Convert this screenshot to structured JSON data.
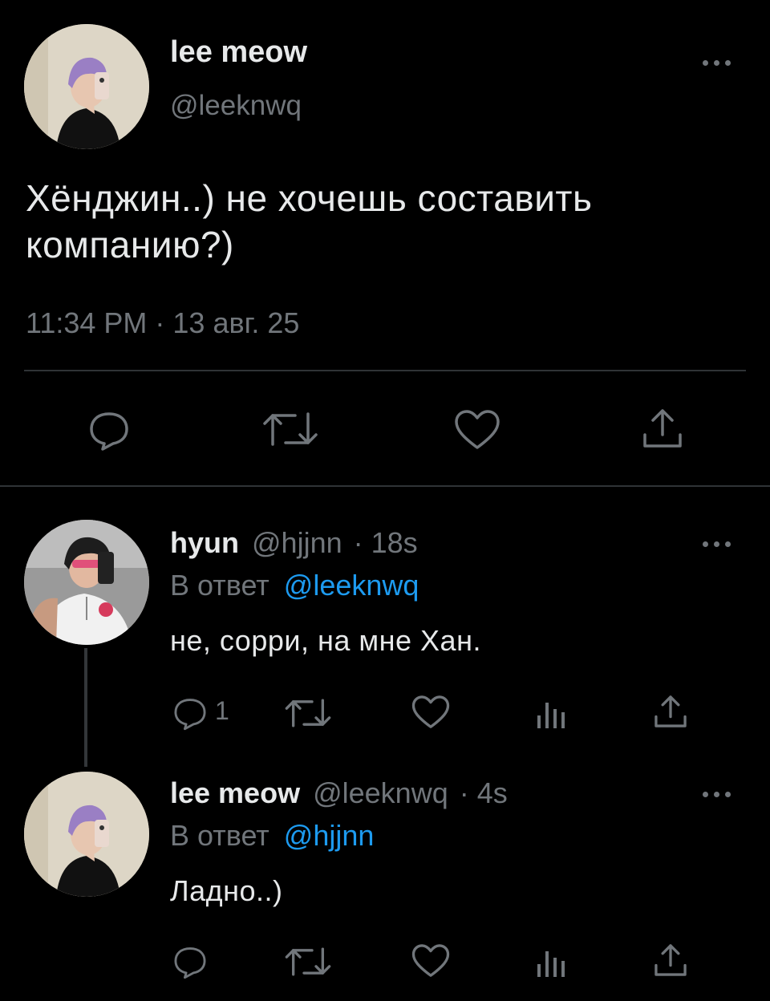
{
  "main_tweet": {
    "display_name": "lee meow",
    "handle": "@leeknwq",
    "text_line1": "Хёнджин..) не хочешь составить",
    "text_line2": "компанию?)",
    "timestamp": "11:34 PM · 13 авг. 25"
  },
  "reply1": {
    "display_name": "hyun",
    "handle": "@hjjnn",
    "time": "· 18s",
    "reply_to_prefix": "В ответ",
    "reply_to_handle": "@leeknwq",
    "text": "не, сорри, на мне Хан.",
    "reply_count": "1"
  },
  "reply2": {
    "display_name": "lee meow",
    "handle": "@leeknwq",
    "time": "· 4s",
    "reply_to_prefix": "В ответ",
    "reply_to_handle": "@hjjnn",
    "text": "Ладно..)"
  },
  "colors": {
    "background": "#000000",
    "text": "#e7e9ea",
    "muted": "#71767b",
    "link": "#1d9bf0",
    "divider": "#2f3336"
  },
  "icons": [
    "more-icon",
    "reply-icon",
    "retweet-icon",
    "like-icon",
    "views-icon",
    "share-icon"
  ]
}
